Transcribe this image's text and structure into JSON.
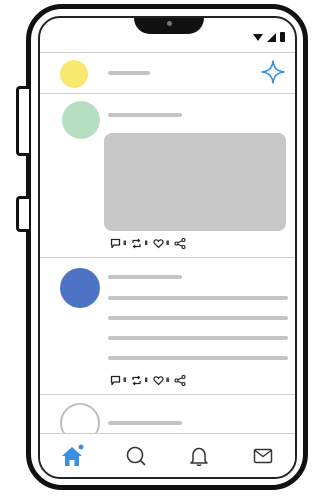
{
  "colors": {
    "accent": "#3b8fe0",
    "self_avatar": "#f7e86e",
    "post1_avatar": "#b6dfc1",
    "post2_avatar": "#4f73c4",
    "placeholder": "#c4c4c4"
  },
  "status_bar": {
    "icons": [
      "wifi-icon",
      "signal-icon",
      "battery-icon"
    ]
  },
  "top_bar": {
    "icons": [
      "avatar",
      "sparkle-icon"
    ]
  },
  "post_action_icons": [
    "comment-icon",
    "repost-icon",
    "like-icon",
    "share-icon"
  ],
  "bottom_nav": {
    "items": [
      "home",
      "search",
      "notifications",
      "messages"
    ],
    "active": "home",
    "icons": [
      "home-icon",
      "search-icon",
      "bell-icon",
      "mail-icon"
    ]
  }
}
